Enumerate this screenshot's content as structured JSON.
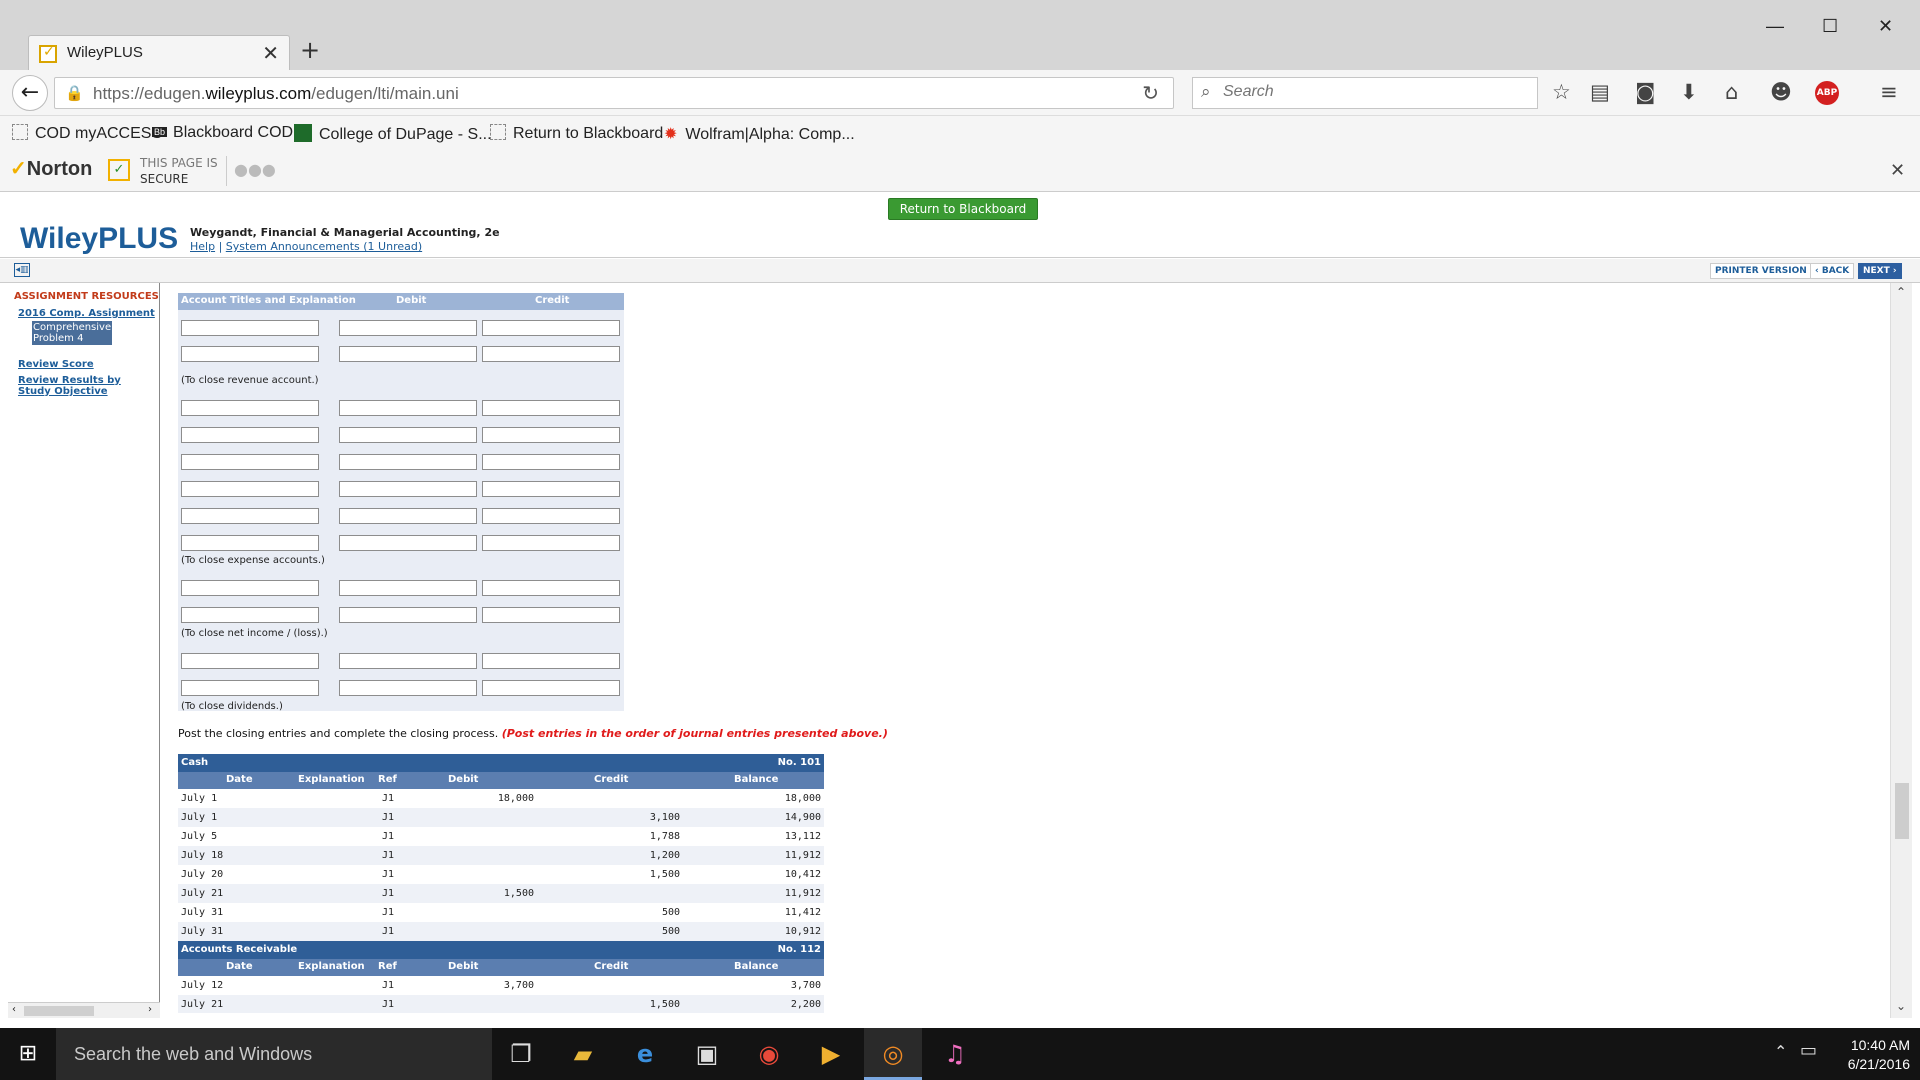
{
  "browser": {
    "tab_title": "WileyPLUS",
    "url_prefix": "https://edugen.",
    "url_domain": "wileyplus.com",
    "url_path": "/edugen/lti/main.uni",
    "search_placeholder": "Search",
    "bookmarks": [
      "COD myACCESS",
      "Blackboard COD",
      "College of DuPage - S...",
      "Return to Blackboard",
      "Wolfram|Alpha: Comp..."
    ],
    "bookmark_badge": "Bb",
    "adblock_label": "ABP"
  },
  "norton": {
    "brand": "Norton",
    "status_line1": "THIS PAGE IS",
    "status_line2": "SECURE"
  },
  "header": {
    "logo": "WileyPLUS",
    "book_title": "Weygandt, Financial & Managerial Accounting, 2e",
    "help_link": "Help",
    "sep": "|",
    "announcements_link": "System Announcements (1 Unread)",
    "return_button": "Return to Blackboard"
  },
  "subbar": {
    "printer": "PRINTER VERSION",
    "back": "‹ BACK",
    "next": "NEXT ›"
  },
  "sidebar": {
    "heading": "ASSIGNMENT RESOURCES",
    "assignment_link": "2016 Comp. Assignment",
    "selected_item": "Comprehensive Problem 4",
    "review_score": "Review Score",
    "review_results": "Review Results by Study Objective"
  },
  "journal": {
    "col_account": "Account Titles and Explanation",
    "col_debit": "Debit",
    "col_credit": "Credit",
    "note_revenue": "(To close revenue account.)",
    "note_expense": "(To close expense accounts.)",
    "note_income": "(To close net income / (loss).)",
    "note_dividends": "(To close dividends.)"
  },
  "post_instruction": "Post the closing entries and complete the closing process.",
  "post_warning": "(Post entries in the order of journal entries presented above.)",
  "ledger_headers": {
    "date": "Date",
    "explanation": "Explanation",
    "ref": "Ref",
    "debit": "Debit",
    "credit": "Credit",
    "balance": "Balance"
  },
  "ledgers": [
    {
      "title": "Cash",
      "number": "No. 101",
      "rows": [
        {
          "date": "July 1",
          "ref": "J1",
          "debit": "18,000",
          "credit": "",
          "balance": "18,000"
        },
        {
          "date": "July 1",
          "ref": "J1",
          "debit": "",
          "credit": "3,100",
          "balance": "14,900"
        },
        {
          "date": "July 5",
          "ref": "J1",
          "debit": "",
          "credit": "1,788",
          "balance": "13,112"
        },
        {
          "date": "July 18",
          "ref": "J1",
          "debit": "",
          "credit": "1,200",
          "balance": "11,912"
        },
        {
          "date": "July 20",
          "ref": "J1",
          "debit": "",
          "credit": "1,500",
          "balance": "10,412"
        },
        {
          "date": "July 21",
          "ref": "J1",
          "debit": "1,500",
          "credit": "",
          "balance": "11,912"
        },
        {
          "date": "July 31",
          "ref": "J1",
          "debit": "",
          "credit": "500",
          "balance": "11,412"
        },
        {
          "date": "July 31",
          "ref": "J1",
          "debit": "",
          "credit": "500",
          "balance": "10,912"
        }
      ]
    },
    {
      "title": "Accounts Receivable",
      "number": "No. 112",
      "rows": [
        {
          "date": "July 12",
          "ref": "J1",
          "debit": "3,700",
          "credit": "",
          "balance": "3,700"
        },
        {
          "date": "July 21",
          "ref": "J1",
          "debit": "",
          "credit": "1,500",
          "balance": "2,200"
        }
      ]
    }
  ],
  "taskbar": {
    "search_placeholder": "Search the web and Windows",
    "time": "10:40 AM",
    "date": "6/21/2016"
  }
}
